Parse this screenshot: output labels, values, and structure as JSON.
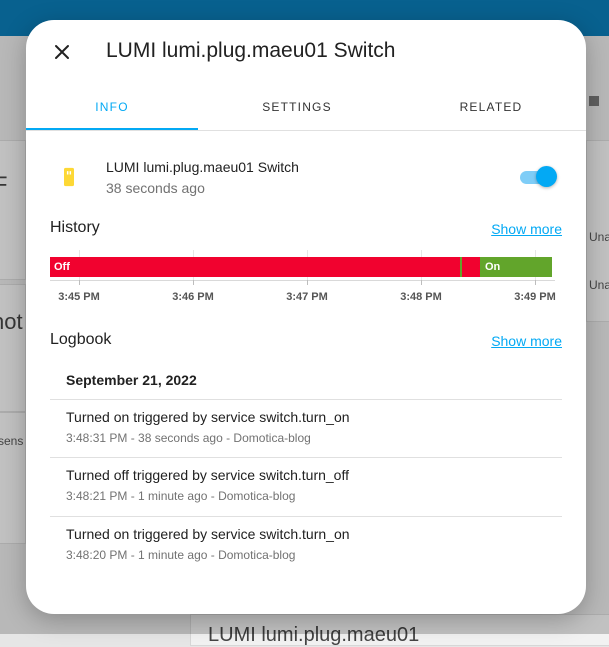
{
  "background": {
    "side_texts": [
      "Una",
      "Una",
      "sens",
      "not",
      "F"
    ],
    "bottom_text": "LUMI lumi.plug.maeu01"
  },
  "dialog": {
    "title": "LUMI lumi.plug.maeu01 Switch",
    "close_icon": "close-icon",
    "tabs": [
      {
        "label": "INFO",
        "active": true
      },
      {
        "label": "SETTINGS",
        "active": false
      },
      {
        "label": "RELATED",
        "active": false
      }
    ]
  },
  "entity": {
    "name": "LUMI lumi.plug.maeu01 Switch",
    "last_changed": "38 seconds ago",
    "icon": "power-plug-icon",
    "state": "on"
  },
  "history": {
    "title": "History",
    "show_more": "Show more",
    "segments": [
      {
        "label": "Off",
        "color": "#f1022f",
        "start": "3:44:52 PM",
        "end": "3:48:20 PM"
      },
      {
        "label": "",
        "color": "#62a52b",
        "start": "3:48:20 PM",
        "end": "3:48:21 PM"
      },
      {
        "label": "",
        "color": "#f1022f",
        "start": "3:48:21 PM",
        "end": "3:48:31 PM"
      },
      {
        "label": "On",
        "color": "#62a52b",
        "start": "3:48:31 PM",
        "end": "3:49:09 PM"
      }
    ],
    "ticks": [
      "3:45 PM",
      "3:46 PM",
      "3:47 PM",
      "3:48 PM",
      "3:49 PM"
    ]
  },
  "logbook": {
    "title": "Logbook",
    "show_more": "Show more",
    "date": "September 21, 2022",
    "entries": [
      {
        "message": "Turned on triggered by service switch.turn_on",
        "meta": "3:48:31 PM - 38 seconds ago - Domotica-blog"
      },
      {
        "message": "Turned off triggered by service switch.turn_off",
        "meta": "3:48:21 PM - 1 minute ago - Domotica-blog"
      },
      {
        "message": "Turned on triggered by service switch.turn_on",
        "meta": "3:48:20 PM - 1 minute ago - Domotica-blog"
      }
    ]
  },
  "colors": {
    "accent": "#03a9f4",
    "off": "#f1022f",
    "on": "#62a52b",
    "header": "#0a7ab3"
  }
}
